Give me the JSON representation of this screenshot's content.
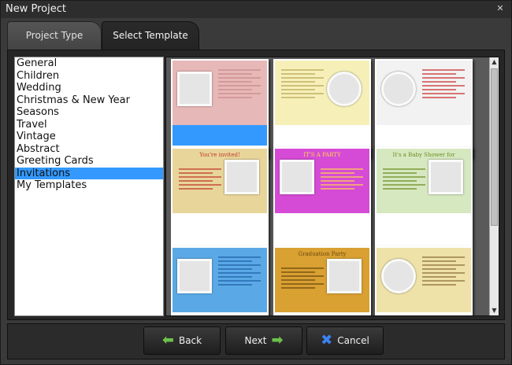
{
  "window": {
    "title": "New Project"
  },
  "tabs": [
    {
      "label": "Project Type"
    },
    {
      "label": "Select Template"
    }
  ],
  "categories": [
    {
      "label": "General"
    },
    {
      "label": "Children"
    },
    {
      "label": "Wedding"
    },
    {
      "label": "Christmas & New Year"
    },
    {
      "label": "Seasons"
    },
    {
      "label": "Travel"
    },
    {
      "label": "Vintage"
    },
    {
      "label": "Abstract"
    },
    {
      "label": "Greeting Cards"
    },
    {
      "label": "Invitations"
    },
    {
      "label": "My Templates"
    }
  ],
  "selected_category": "Invitations",
  "templates": [
    {
      "bg": "#e7b8b8",
      "accent": "#c98a8a",
      "title": ""
    },
    {
      "bg": "#f6f0b8",
      "accent": "#b9a65a",
      "title": ""
    },
    {
      "bg": "#f2f2f2",
      "accent": "#c83030",
      "title": ""
    },
    {
      "bg": "#e8d59a",
      "accent": "#c0392b",
      "title": "You're invited!"
    },
    {
      "bg": "#d54bd6",
      "accent": "#ffd34d",
      "title": "IT'S A PARTY"
    },
    {
      "bg": "#d6e8c0",
      "accent": "#6b8e23",
      "title": "It's a Baby Shower for"
    },
    {
      "bg": "#5aa9e6",
      "accent": "#1f5fa8",
      "title": ""
    },
    {
      "bg": "#d9a032",
      "accent": "#6b4a0e",
      "title": "Graduation Party"
    },
    {
      "bg": "#efe2a8",
      "accent": "#8b6d3a",
      "title": ""
    }
  ],
  "buttons": {
    "back": "Back",
    "next": "Next",
    "cancel": "Cancel"
  },
  "icons": {
    "close": "close-icon",
    "back": "arrow-left-icon",
    "next": "arrow-right-icon",
    "cancel": "x-mark-icon"
  }
}
